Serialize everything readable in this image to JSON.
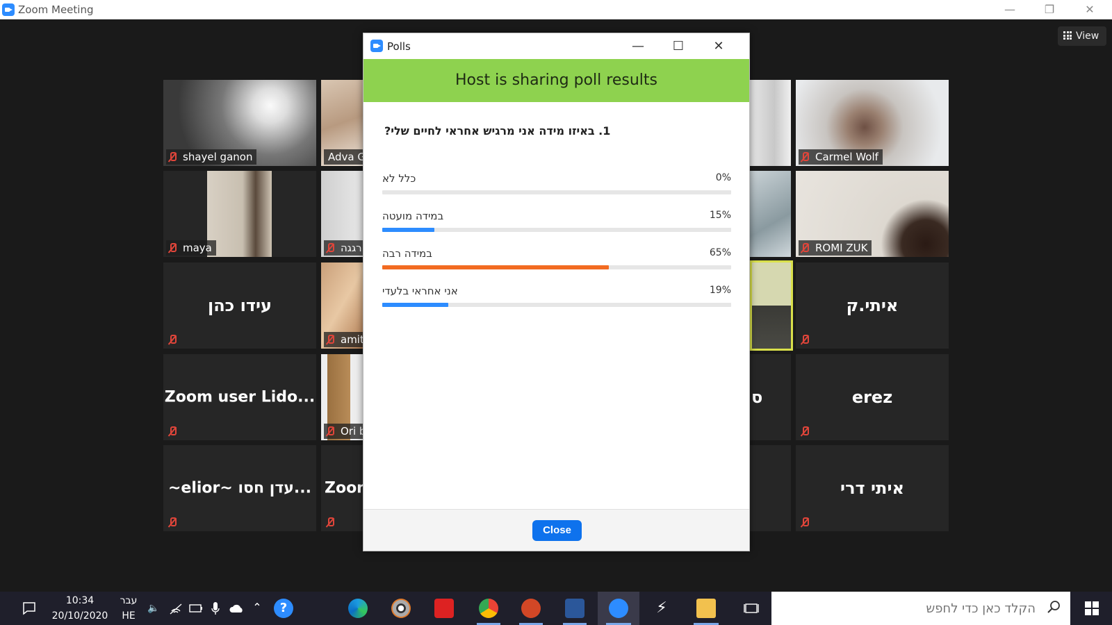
{
  "window": {
    "title": "Zoom Meeting",
    "view_label": "View"
  },
  "participants": [
    {
      "name": "shayel ganon"
    },
    {
      "name": "Adva Go"
    },
    {
      "name": "Carmel Wolf"
    },
    {
      "name": "maya"
    },
    {
      "name": "רגגה"
    },
    {
      "name": "ROMI ZUK"
    },
    {
      "name": "עידו כהן",
      "big": "עידו כהן"
    },
    {
      "name": "amit"
    },
    {
      "name": "איתי.ק",
      "big": "איתי.ק"
    },
    {
      "name": "Zoom user Lido...",
      "big": "Zoom user Lido..."
    },
    {
      "name": "Ori b"
    },
    {
      "name": "ס",
      "big": "ס"
    },
    {
      "name": "erez",
      "big": "erez"
    },
    {
      "name": "~elior~ עדן חסו...",
      "big": "~elior~ עדן חסו..."
    },
    {
      "name": "Zoom",
      "big": "Zoom"
    },
    {
      "name": "איתי דרי",
      "big": "איתי דרי"
    }
  ],
  "poll": {
    "window_title": "Polls",
    "banner": "Host is sharing poll results",
    "question": "1. באיזו מידה אני מרגיש אחראי לחיים שלי?",
    "options": [
      {
        "label": "כלל לא",
        "percent_text": "0%",
        "percent": 0,
        "color": "#2d8cff"
      },
      {
        "label": "במידה מועטה",
        "percent_text": "15%",
        "percent": 15,
        "color": "#2d8cff"
      },
      {
        "label": "במידה רבה",
        "percent_text": "65%",
        "percent": 65,
        "color": "#f26b21"
      },
      {
        "label": "אני אחראי בלעדי",
        "percent_text": "19%",
        "percent": 19,
        "color": "#2d8cff"
      }
    ],
    "close_label": "Close"
  },
  "taskbar": {
    "time": "10:34",
    "date": "20/10/2020",
    "lang_top": "עבר",
    "lang_bottom": "HE",
    "search_placeholder": "הקלד כאן כדי לחפש"
  }
}
